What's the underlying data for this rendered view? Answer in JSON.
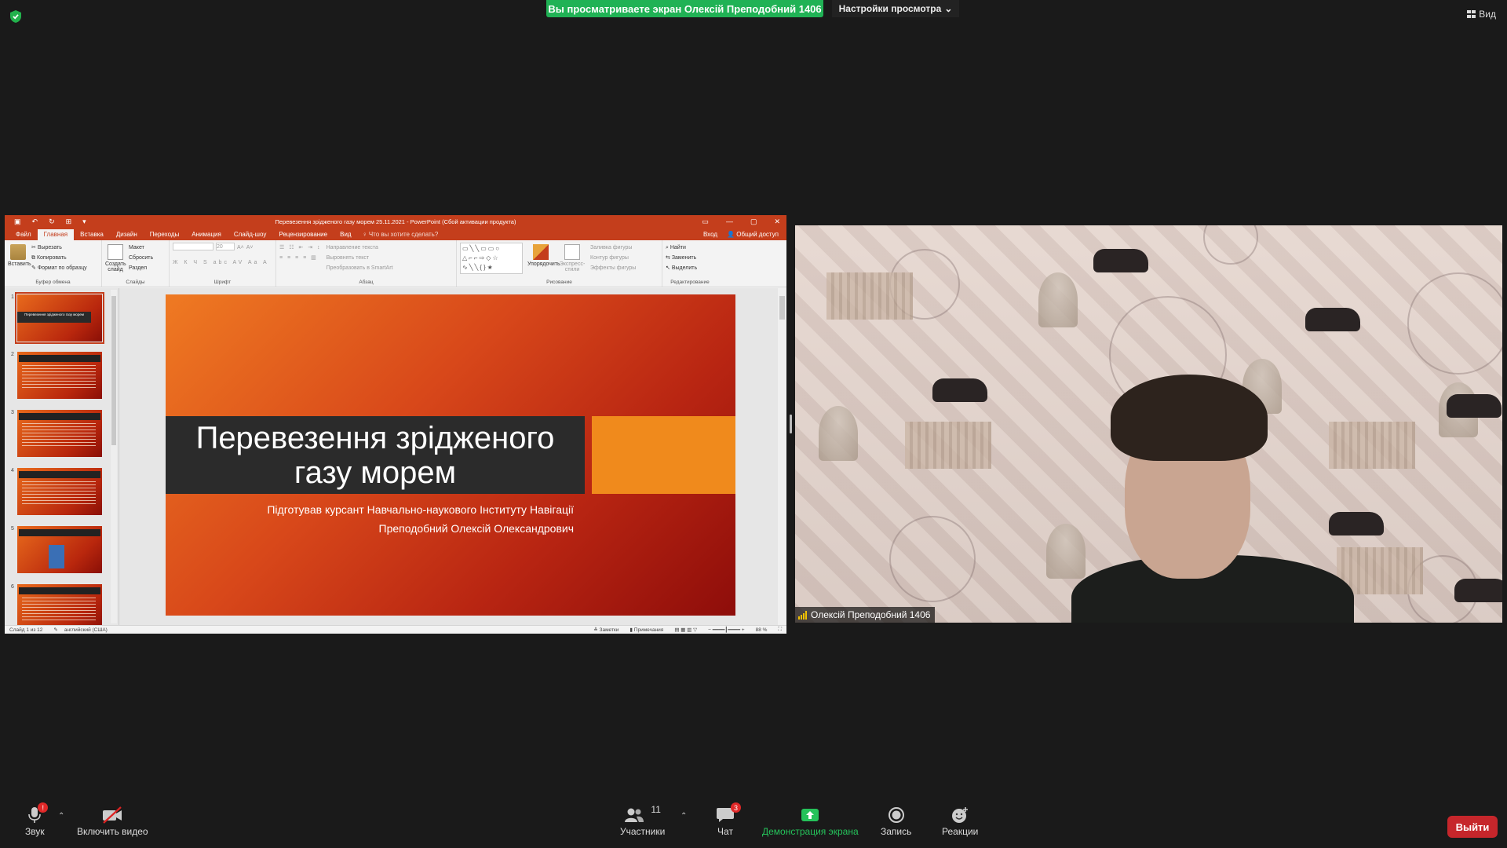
{
  "top": {
    "share_banner": "Вы просматриваете экран Олексій Преподобний 1406",
    "view_options": "Настройки просмотра",
    "view_label": "Вид"
  },
  "ppt": {
    "window_title": "Перевезення зрідженого газу морем 25.11.2021 - PowerPoint (Сбой активации продукта)",
    "tabs": [
      "Файл",
      "Главная",
      "Вставка",
      "Дизайн",
      "Переходы",
      "Анимация",
      "Слайд-шоу",
      "Рецензирование",
      "Вид"
    ],
    "tell_me": "Что вы хотите сделать?",
    "sign_in": "Вход",
    "share": "Общий доступ",
    "ribbon": {
      "paste": "Вставить",
      "cut": "Вырезать",
      "copy": "Копировать",
      "format_painter": "Формат по образцу",
      "clipboard_group": "Буфер обмена",
      "new_slide": "Создать слайд",
      "layout": "Макет",
      "reset": "Сбросить",
      "section": "Раздел",
      "slides_group": "Слайды",
      "font_size": "20",
      "font_group": "Шрифт",
      "text_direction": "Направление текста",
      "align_text": "Выровнять текст",
      "smartart": "Преобразовать в SmartArt",
      "paragraph_group": "Абзац",
      "arrange": "Упорядочить",
      "quick_styles": "Экспресс-стили",
      "shape_fill": "Заливка фигуры",
      "shape_outline": "Контур фигуры",
      "shape_effects": "Эффекты фигуры",
      "drawing_group": "Рисование",
      "find": "Найти",
      "replace": "Заменить",
      "select": "Выделить",
      "editing_group": "Редактирование"
    },
    "thumbnails": [
      {
        "num": "1",
        "title": "Перевезення зрідженого газу морем"
      },
      {
        "num": "2"
      },
      {
        "num": "3"
      },
      {
        "num": "4"
      },
      {
        "num": "5"
      },
      {
        "num": "6"
      }
    ],
    "slide": {
      "title": "Перевезення зрідженого газу морем",
      "subtitle_line1": "Підготував курсант Навчально-наукового Інституту Навігації",
      "subtitle_line2": "Преподобний Олексій Олександрович"
    },
    "status": {
      "slide_info": "Слайд 1 из 12",
      "language": "английский (США)",
      "notes": "Заметки",
      "comments": "Примечания",
      "zoom": "88 %"
    }
  },
  "camera": {
    "participant_name": "Олексій Преподобний 1406"
  },
  "toolbar": {
    "audio_label": "Звук",
    "audio_badge": "!",
    "video_label": "Включить видео",
    "participants_label": "Участники",
    "participants_count": "11",
    "chat_label": "Чат",
    "chat_badge": "3",
    "share_label": "Демонстрация экрана",
    "record_label": "Запись",
    "reactions_label": "Реакции",
    "leave_label": "Выйти"
  },
  "colors": {
    "share_green": "#20b255",
    "ppt_red": "#c43e1c",
    "leave_red": "#c6262b"
  }
}
